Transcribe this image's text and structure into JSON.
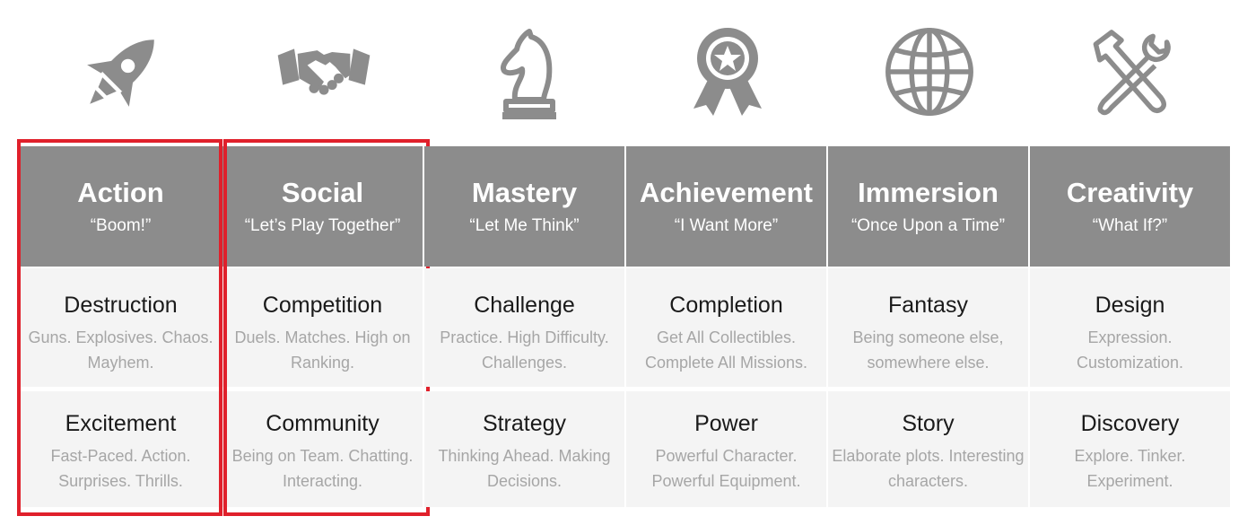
{
  "accent_color": "#e0202b",
  "header_bg": "#8c8c8c",
  "columns": [
    {
      "icon": "rocket-icon",
      "title": "Action",
      "quote": "“Boom!”",
      "s1_title": "Destruction",
      "s1_desc": "Guns. Explosives. Chaos. Mayhem.",
      "s2_title": "Excitement",
      "s2_desc": "Fast-Paced. Action. Surprises. Thrills.",
      "highlighted": true
    },
    {
      "icon": "handshake-icon",
      "title": "Social",
      "quote": "“Let’s Play Together”",
      "s1_title": "Competition",
      "s1_desc": "Duels. Matches. High on Ranking.",
      "s2_title": "Community",
      "s2_desc": "Being on Team. Chatting. Interacting.",
      "highlighted": true
    },
    {
      "icon": "chess-knight-icon",
      "title": "Mastery",
      "quote": "“Let Me Think”",
      "s1_title": "Challenge",
      "s1_desc": "Practice. High Difficulty. Challenges.",
      "s2_title": "Strategy",
      "s2_desc": "Thinking Ahead. Making Decisions.",
      "highlighted": false
    },
    {
      "icon": "award-ribbon-icon",
      "title": "Achievement",
      "quote": "“I Want More”",
      "s1_title": "Completion",
      "s1_desc": "Get All Collectibles. Complete All Missions.",
      "s2_title": "Power",
      "s2_desc": "Powerful Character. Powerful Equipment.",
      "highlighted": false
    },
    {
      "icon": "globe-icon",
      "title": "Immersion",
      "quote": "“Once Upon a Time”",
      "s1_title": "Fantasy",
      "s1_desc": "Being someone else, somewhere else.",
      "s2_title": "Story",
      "s2_desc": "Elaborate plots. Interesting characters.",
      "highlighted": false
    },
    {
      "icon": "hammer-wrench-icon",
      "title": "Creativity",
      "quote": "“What If?”",
      "s1_title": "Design",
      "s1_desc": "Expression. Customization.",
      "s2_title": "Discovery",
      "s2_desc": "Explore. Tinker. Experiment.",
      "highlighted": false
    }
  ]
}
